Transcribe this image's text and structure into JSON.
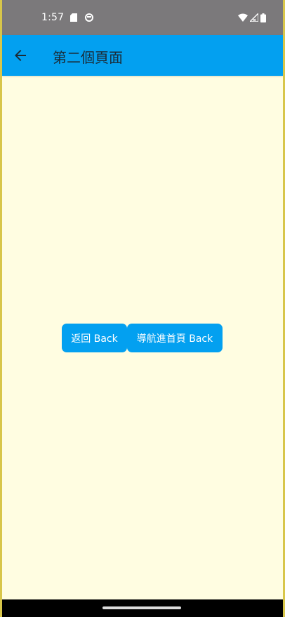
{
  "status_bar": {
    "time": "1:57",
    "icons": [
      "sd-card-icon",
      "sync-icon",
      "wifi-icon",
      "signal-icon",
      "battery-icon"
    ]
  },
  "app_bar": {
    "title": "第二個頁面",
    "back_icon": "arrow-left-icon",
    "color": "#03a0f0"
  },
  "buttons": {
    "back_label": "返回 Back",
    "home_label": "導航進首頁 Back"
  },
  "colors": {
    "background": "#fffde1",
    "accent": "#03a0f0",
    "status_bar": "#7b797b"
  }
}
